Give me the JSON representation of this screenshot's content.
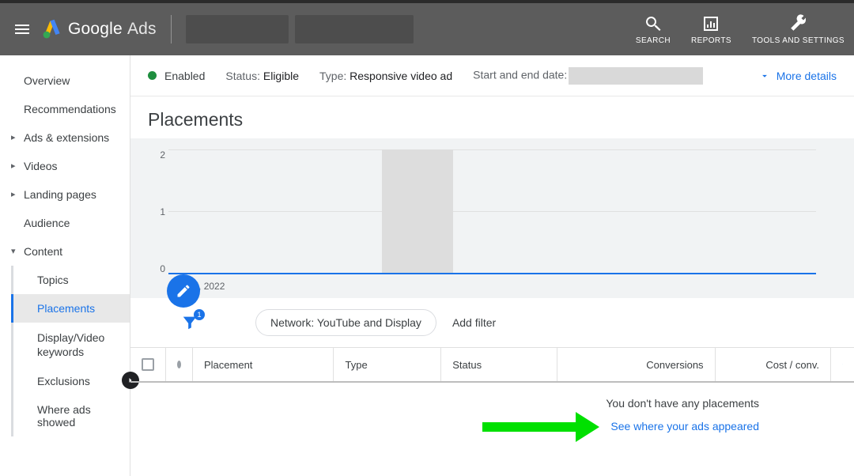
{
  "header": {
    "brand_main": "Google",
    "brand_sub": "Ads",
    "actions": {
      "search": "SEARCH",
      "reports": "REPORTS",
      "tools": "TOOLS AND SETTINGS"
    }
  },
  "sidebar": {
    "items": [
      {
        "label": "Overview"
      },
      {
        "label": "Recommendations"
      },
      {
        "label": "Ads & extensions"
      },
      {
        "label": "Videos"
      },
      {
        "label": "Landing pages"
      },
      {
        "label": "Audience"
      },
      {
        "label": "Content"
      }
    ],
    "content_subs": [
      {
        "label": "Topics"
      },
      {
        "label": "Placements"
      },
      {
        "label": "Display/Video keywords"
      },
      {
        "label": "Exclusions"
      },
      {
        "label": "Where ads showed"
      }
    ]
  },
  "statusbar": {
    "enabled": "Enabled",
    "status_label": "Status:",
    "status_value": "Eligible",
    "type_label": "Type:",
    "type_value": "Responsive video ad",
    "dates_label": "Start and end date:",
    "more": "More details"
  },
  "page": {
    "title": "Placements"
  },
  "chart_data": {
    "type": "line",
    "x": [
      "Aug 17, 2022"
    ],
    "yticks": [
      0,
      1,
      2
    ],
    "ylim": [
      0,
      2
    ],
    "series": [
      {
        "name": "Placements",
        "values": [
          0
        ]
      }
    ],
    "xlabel_visible": "Aug 17, 2022"
  },
  "filter": {
    "badge": "1",
    "chip": "Network: YouTube and Display",
    "add": "Add filter"
  },
  "table": {
    "cols": [
      "Placement",
      "Type",
      "Status",
      "Conversions",
      "Cost / conv."
    ],
    "empty_msg": "You don't have any placements",
    "see_link": "See where your ads appeared"
  }
}
